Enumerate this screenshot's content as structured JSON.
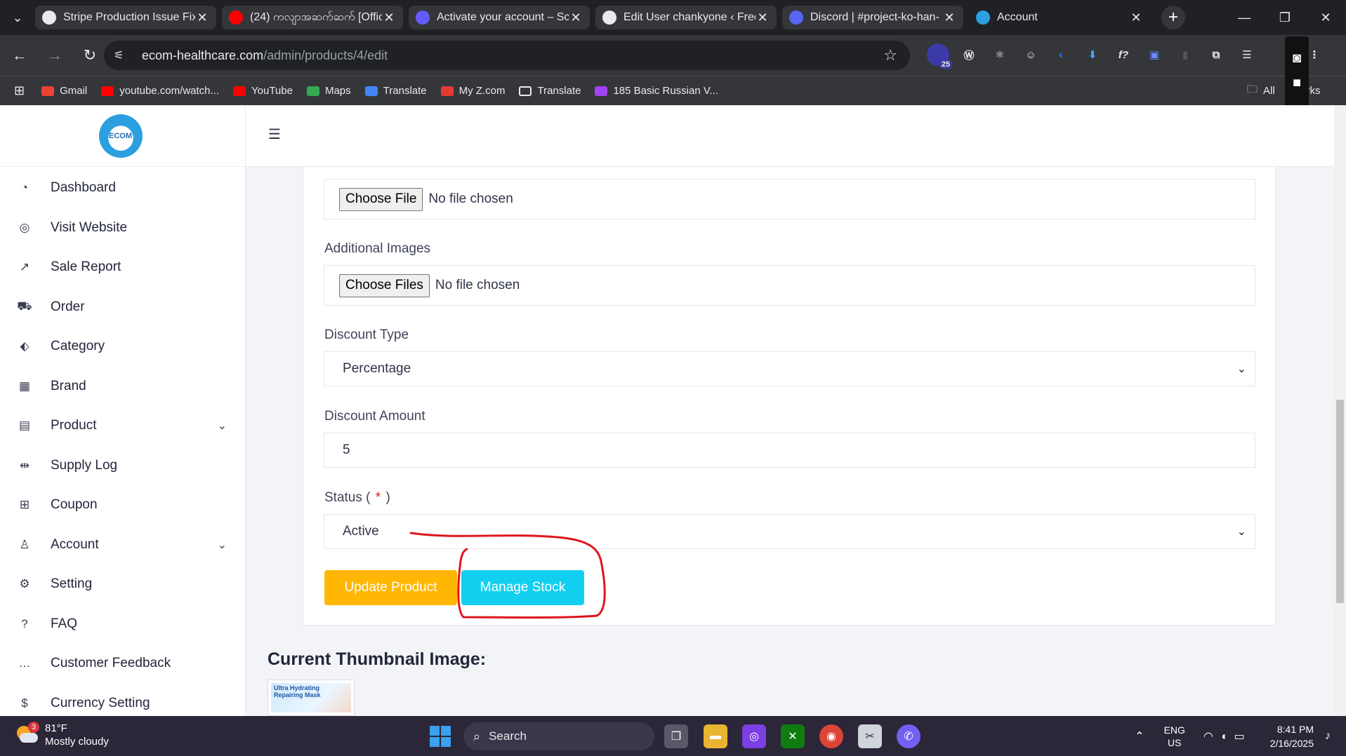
{
  "browser": {
    "tabs": [
      {
        "title": "Stripe Production Issue Fix",
        "icon": "github-icon",
        "color": "#e8eaed"
      },
      {
        "title": "(24) ကလျာအဆက်ဆက် [Offic",
        "icon": "youtube-icon",
        "color": "#ff0000"
      },
      {
        "title": "Activate your account – Sc",
        "icon": "s-logo-icon",
        "color": "#635bff"
      },
      {
        "title": "Edit User chankyone ‹ Free",
        "icon": "wordpress-icon",
        "color": "#e8eaed"
      },
      {
        "title": "Discord | #project-ko-han-",
        "icon": "discord-icon",
        "color": "#5865f2"
      },
      {
        "title": "Account",
        "icon": "ecom-icon",
        "color": "#2b9fe0"
      }
    ],
    "url_host": "ecom-healthcare.com",
    "url_path": "/admin/products/4/edit",
    "extension_badge": "25",
    "bookmarks": [
      {
        "label": "Gmail",
        "icon": "gmail-icon",
        "color": "#ea4335"
      },
      {
        "label": "youtube.com/watch...",
        "icon": "youtube-icon",
        "color": "#ff0000"
      },
      {
        "label": "YouTube",
        "icon": "youtube-icon",
        "color": "#ff0000"
      },
      {
        "label": "Maps",
        "icon": "maps-icon",
        "color": "#34a853"
      },
      {
        "label": "Translate",
        "icon": "translate-icon",
        "color": "#4285f4"
      },
      {
        "label": "My Z.com",
        "icon": "z-icon",
        "color": "#e53935"
      },
      {
        "label": "Translate",
        "icon": "folder-icon",
        "color": "#35363a"
      },
      {
        "label": "185 Basic Russian V...",
        "icon": "course-icon",
        "color": "#a142f4"
      }
    ],
    "bookmarks_right": "All",
    "bookmarks_right_suffix": "marks"
  },
  "sidebar": {
    "logo_text": "ECOM",
    "items": [
      {
        "label": "Dashboard",
        "icon": "dashboard-icon",
        "glyph": "◔"
      },
      {
        "label": "Visit Website",
        "icon": "globe-icon",
        "glyph": "◎"
      },
      {
        "label": "Sale Report",
        "icon": "chart-line-icon",
        "glyph": "↗"
      },
      {
        "label": "Order",
        "icon": "cart-icon",
        "glyph": "⛟"
      },
      {
        "label": "Category",
        "icon": "tag-icon",
        "glyph": "⬖"
      },
      {
        "label": "Brand",
        "icon": "grid-icon",
        "glyph": "▦"
      },
      {
        "label": "Product",
        "icon": "box-icon",
        "glyph": "▤",
        "has_submenu": true
      },
      {
        "label": "Supply Log",
        "icon": "truck-icon",
        "glyph": "⇹"
      },
      {
        "label": "Coupon",
        "icon": "gift-icon",
        "glyph": "⊞"
      },
      {
        "label": "Account",
        "icon": "user-icon",
        "glyph": "♙",
        "has_submenu": true
      },
      {
        "label": "Setting",
        "icon": "gear-icon",
        "glyph": "⚙"
      },
      {
        "label": "FAQ",
        "icon": "question-icon",
        "glyph": "?"
      },
      {
        "label": "Customer Feedback",
        "icon": "chat-icon",
        "glyph": "…"
      },
      {
        "label": "Currency Setting",
        "icon": "dollar-icon",
        "glyph": "$"
      }
    ]
  },
  "form": {
    "thumbnail_file_button": "Choose File",
    "thumbnail_file_status": "No file chosen",
    "additional_images_label": "Additional Images",
    "additional_file_button": "Choose Files",
    "additional_file_status": "No file chosen",
    "discount_type_label": "Discount Type",
    "discount_type_value": "Percentage",
    "discount_amount_label": "Discount Amount",
    "discount_amount_value": "5",
    "status_label": "Status (",
    "status_required": "*",
    "status_label_end": ")",
    "status_value": "Active",
    "update_button": "Update Product",
    "manage_stock_button": "Manage Stock",
    "colors": {
      "update": "#ffb703",
      "manage_stock": "#12cff0",
      "required": "#e11d2b",
      "annotation": "#e0141c"
    }
  },
  "thumbnail": {
    "heading": "Current Thumbnail Image:",
    "image_text_1": "Ultra Hydrating",
    "image_text_2": "Repairing Mask"
  },
  "taskbar": {
    "weather_temp": "81°F",
    "weather_desc": "Mostly cloudy",
    "weather_badge": "3",
    "search_placeholder": "Search",
    "lang_1": "ENG",
    "lang_2": "US",
    "time": "8:41 PM",
    "date": "2/16/2025"
  }
}
